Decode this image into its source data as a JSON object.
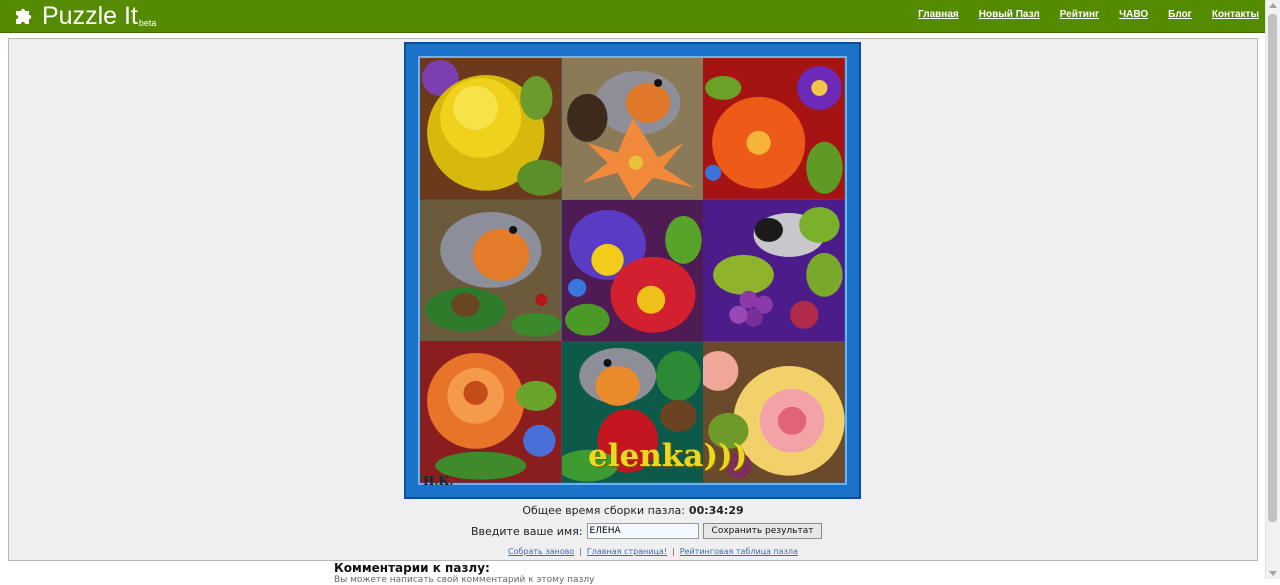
{
  "header": {
    "logo_text": "Puzzle It",
    "logo_beta": "beta",
    "nav": [
      {
        "label": "Главная"
      },
      {
        "label": "Новый Пазл"
      },
      {
        "label": "Рейтинг"
      },
      {
        "label": "ЧАВО"
      },
      {
        "label": "Блог"
      },
      {
        "label": "Контакты"
      }
    ],
    "bar_color": "#558b00"
  },
  "puzzle": {
    "signature": "elenka)))",
    "initials": "Н.К."
  },
  "result": {
    "time_label": "Общее время сборки пазла:",
    "time_value": "00:34:29",
    "name_label": "Введите ваше имя:",
    "name_value": "ЕЛЕНА",
    "save_label": "Сохранить результат"
  },
  "links": [
    {
      "label": "Собрать заново"
    },
    {
      "label": "Главная страница!"
    },
    {
      "label": "Рейтинговая таблица пазла"
    }
  ],
  "comments": {
    "title": "Комментарии к пазлу:",
    "subtitle": "Вы можете написать свой комментарий к этому пазлу"
  }
}
